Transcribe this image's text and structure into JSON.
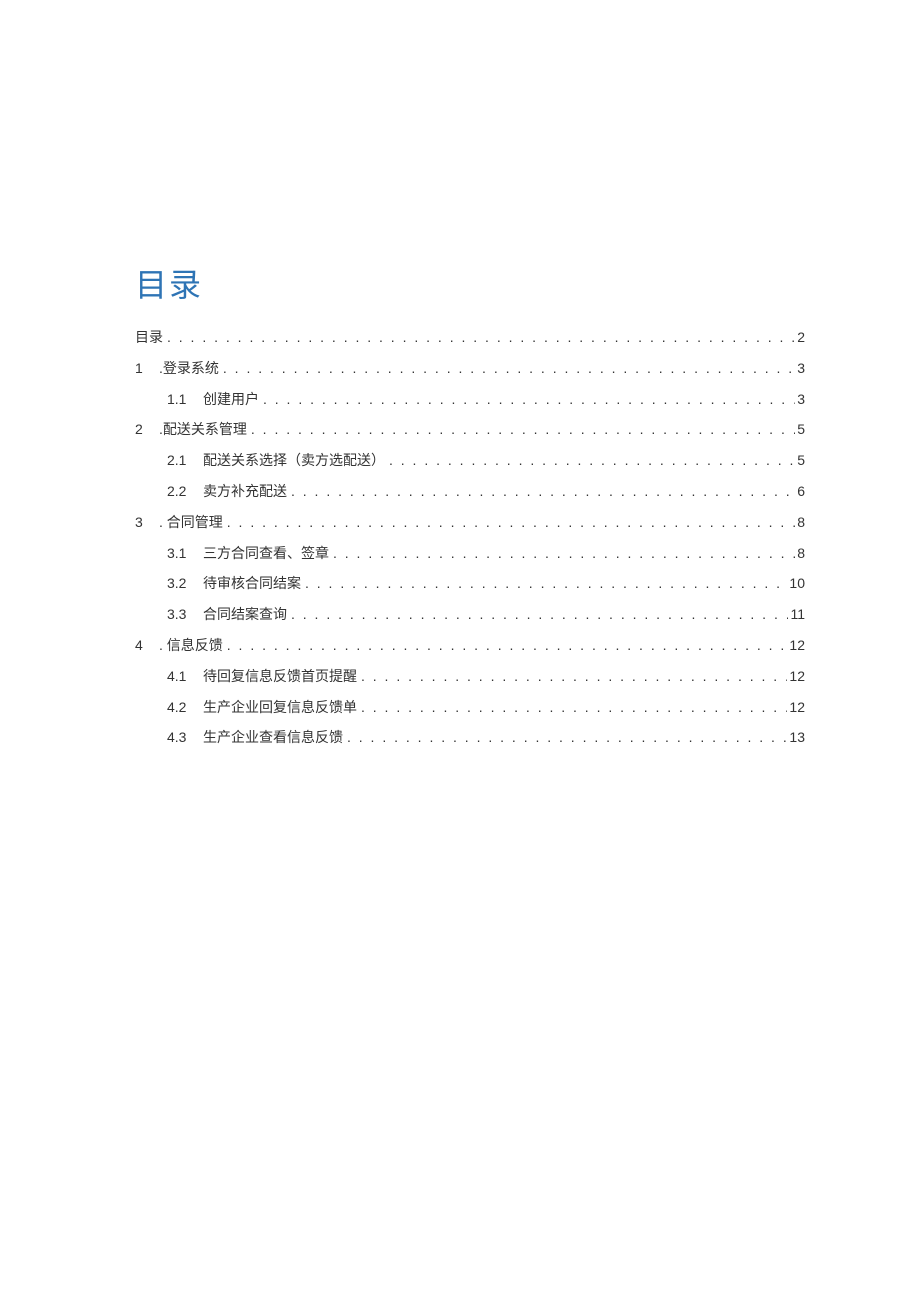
{
  "title": "目录",
  "toc": [
    {
      "level": 0,
      "num": "",
      "label": "目录",
      "page": "2"
    },
    {
      "level": 1,
      "num": "1",
      "label": ".登录系统",
      "page": "3"
    },
    {
      "level": 2,
      "num": "1.1",
      "label": "创建用户",
      "page": "3"
    },
    {
      "level": 1,
      "num": "2",
      "label": ".配送关系管理",
      "page": "5"
    },
    {
      "level": 2,
      "num": "2.1",
      "label": "配送关系选择（卖方选配送）",
      "page": "5"
    },
    {
      "level": 2,
      "num": "2.2",
      "label": "卖方补充配送",
      "page": "6"
    },
    {
      "level": 1,
      "num": "3",
      "label": ". 合同管理",
      "page": "8"
    },
    {
      "level": 2,
      "num": "3.1",
      "label": "三方合同查看、签章",
      "page": "8"
    },
    {
      "level": 2,
      "num": "3.2",
      "label": "待审核合同结案",
      "page": "10"
    },
    {
      "level": 2,
      "num": "3.3",
      "label": "合同结案查询",
      "page": "11"
    },
    {
      "level": 1,
      "num": "4",
      "label": ". 信息反馈",
      "page": "12"
    },
    {
      "level": 2,
      "num": "4.1",
      "label": "待回复信息反馈首页提醒",
      "page": "12"
    },
    {
      "level": 2,
      "num": "4.2",
      "label": "生产企业回复信息反馈单",
      "page": "12"
    },
    {
      "level": 2,
      "num": "4.3",
      "label": "生产企业查看信息反馈",
      "page": "13"
    }
  ]
}
